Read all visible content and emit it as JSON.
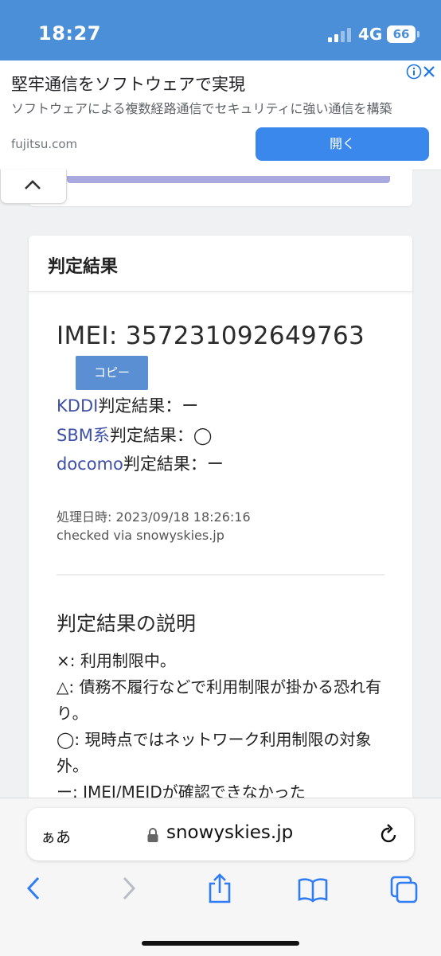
{
  "status_bar": {
    "time": "18:27",
    "network": "4G",
    "battery": "66"
  },
  "ad": {
    "title": "堅牢通信をソフトウェアで実現",
    "description": "ソフトウェアによる複数経路通信でセキュリティに強い通信を構築",
    "domain": "fujitsu.com",
    "open_label": "開く",
    "info_icon": "info-icon",
    "close_icon": "close-icon"
  },
  "result_card": {
    "title": "判定結果",
    "imei_label": "IMEI: 357231092649763",
    "copy_label": "コピー",
    "results": [
      {
        "carrier": "KDDI",
        "suffix": "判定結果：ー"
      },
      {
        "carrier": "SBM系",
        "suffix": "判定結果：◯"
      },
      {
        "carrier": "docomo",
        "suffix": "判定結果：ー"
      }
    ],
    "processed_at": "処理日時: 2023/09/18 18:26:16",
    "checked_via": "checked via snowyskies.jp",
    "explanation_title": "判定結果の説明",
    "explanation_lines": [
      "×: 利用制限中。",
      "△: 債務不履行などで利用制限が掛かる恐れ有り。",
      "◯: 現時点ではネットワーク利用制限の対象外。",
      "ー: IMEI/MEIDが確認できなかった"
    ]
  },
  "browser": {
    "text_size_label": "ぁあ",
    "url": "snowyskies.jp",
    "icons": [
      "lock-icon",
      "reload-icon",
      "back-icon",
      "forward-icon",
      "share-icon",
      "bookmarks-icon",
      "tabs-icon"
    ]
  }
}
